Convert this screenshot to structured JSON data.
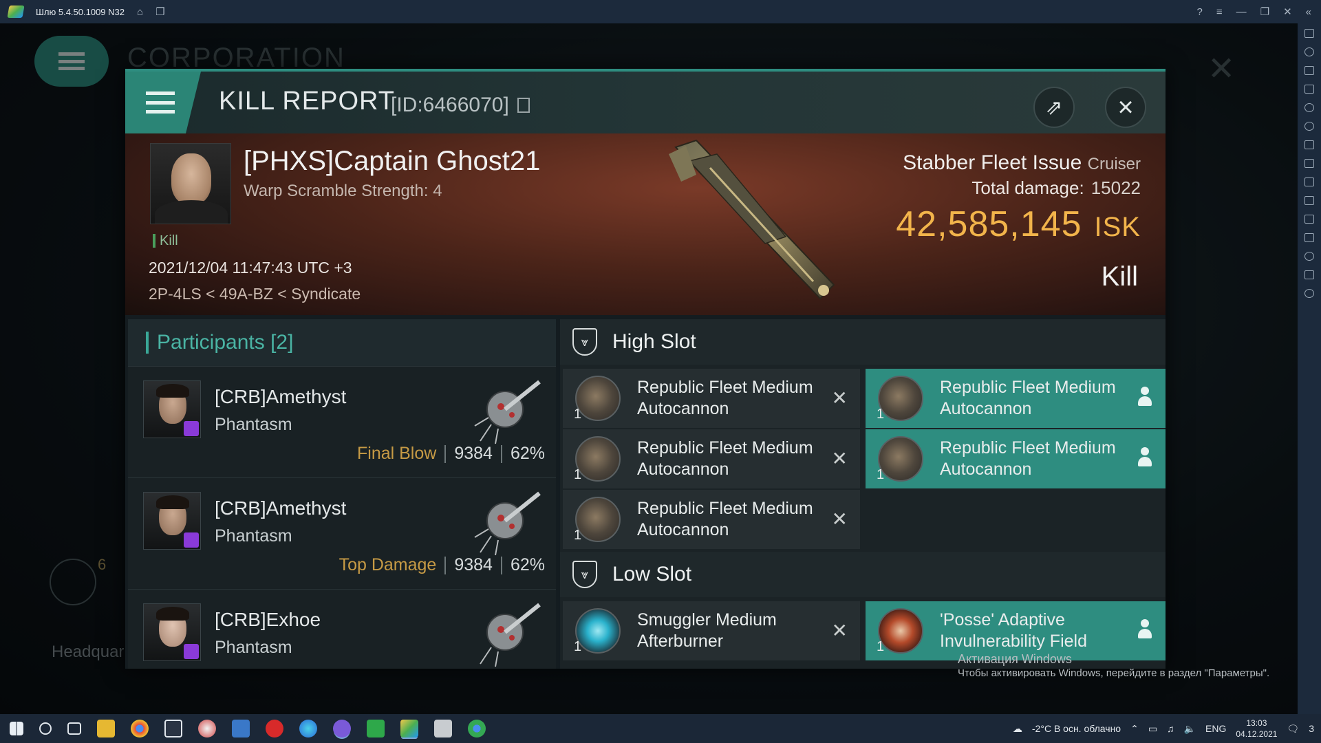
{
  "emulator": {
    "title": "Шлю 5.4.50.1009 N32"
  },
  "background": {
    "section_title": "CORPORATION",
    "bottom_label": "Headquar",
    "count": "6"
  },
  "report": {
    "title": "KILL REPORT",
    "id_label": "[ID:6466070]"
  },
  "victim": {
    "name": "[PHXS]Captain Ghost21",
    "subtitle": "Warp Scramble Strength: 4",
    "kill_tag": "Kill",
    "datetime": "2021/12/04 11:47:43 UTC +3",
    "location": "2P-4LS < 49A-BZ < Syndicate",
    "ship_name": "Stabber Fleet Issue",
    "ship_class": "Cruiser",
    "damage_label": "Total damage:",
    "damage_value": "15022",
    "isk_value": "42,585,145",
    "isk_unit": "ISK",
    "result": "Kill"
  },
  "participants": {
    "header": "Participants",
    "count": "[2]",
    "rows": [
      {
        "name": "[CRB]Amethyst",
        "ship": "Phantasm",
        "tag": "Final Blow",
        "damage": "9384",
        "percent": "62%"
      },
      {
        "name": "[CRB]Amethyst",
        "ship": "Phantasm",
        "tag": "Top Damage",
        "damage": "9384",
        "percent": "62%"
      },
      {
        "name": "[CRB]Exhoe",
        "ship": "Phantasm",
        "tag": "",
        "damage": "",
        "percent": ""
      }
    ]
  },
  "fitting": {
    "high_slot_label": "High Slot",
    "low_slot_label": "Low Slot",
    "high_dropped": [
      {
        "qty": "1",
        "name": "Republic Fleet Medium Autocannon"
      },
      {
        "qty": "1",
        "name": "Republic Fleet Medium Autocannon"
      },
      {
        "qty": "1",
        "name": "Republic Fleet Medium Autocannon"
      }
    ],
    "high_survived": [
      {
        "qty": "1",
        "name": "Republic Fleet Medium Autocannon"
      },
      {
        "qty": "1",
        "name": "Republic Fleet Medium Autocannon"
      }
    ],
    "low_dropped": [
      {
        "qty": "1",
        "name": "Smuggler Medium Afterburner"
      }
    ],
    "low_survived": [
      {
        "qty": "1",
        "name": "'Posse' Adaptive Invulnerability Field"
      }
    ]
  },
  "watermark": {
    "line1": "Активация Windows",
    "line2": "Чтобы активировать Windows, перейдите в раздел \"Параметры\"."
  },
  "taskbar": {
    "weather": "-2°C  В осн. облачно",
    "lang": "ENG",
    "time": "13:03",
    "date": "04.12.2021",
    "notifications": "3"
  }
}
